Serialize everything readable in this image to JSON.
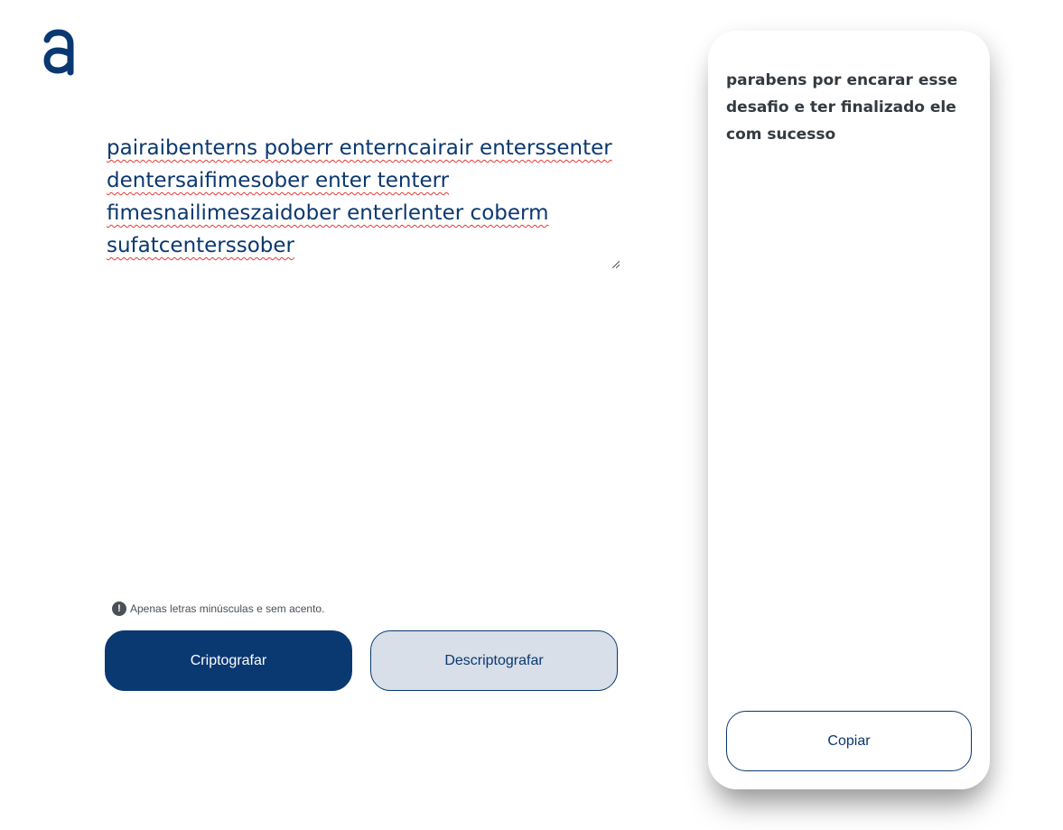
{
  "brand": {
    "logo_icon": "alura-a-logo-icon",
    "color": "#0a3871"
  },
  "editor": {
    "text": "pairaibenterns poberr enterncairair enterssenter dentersaifimesober enter tenterr fimesnailimeszaidober enterlenter coberm sufatcenterssober"
  },
  "hint": {
    "icon": "exclamation-circle-icon",
    "text": "Apenas letras minúsculas e sem acento."
  },
  "actions": {
    "encrypt_label": "Criptografar",
    "decrypt_label": "Descriptografar"
  },
  "output": {
    "text": "parabens por encarar esse desafio e ter finalizado ele com sucesso",
    "copy_label": "Copiar"
  },
  "colors": {
    "primary": "#0a3871",
    "secondary": "#d8dfe8",
    "text_dark": "#343a40"
  }
}
